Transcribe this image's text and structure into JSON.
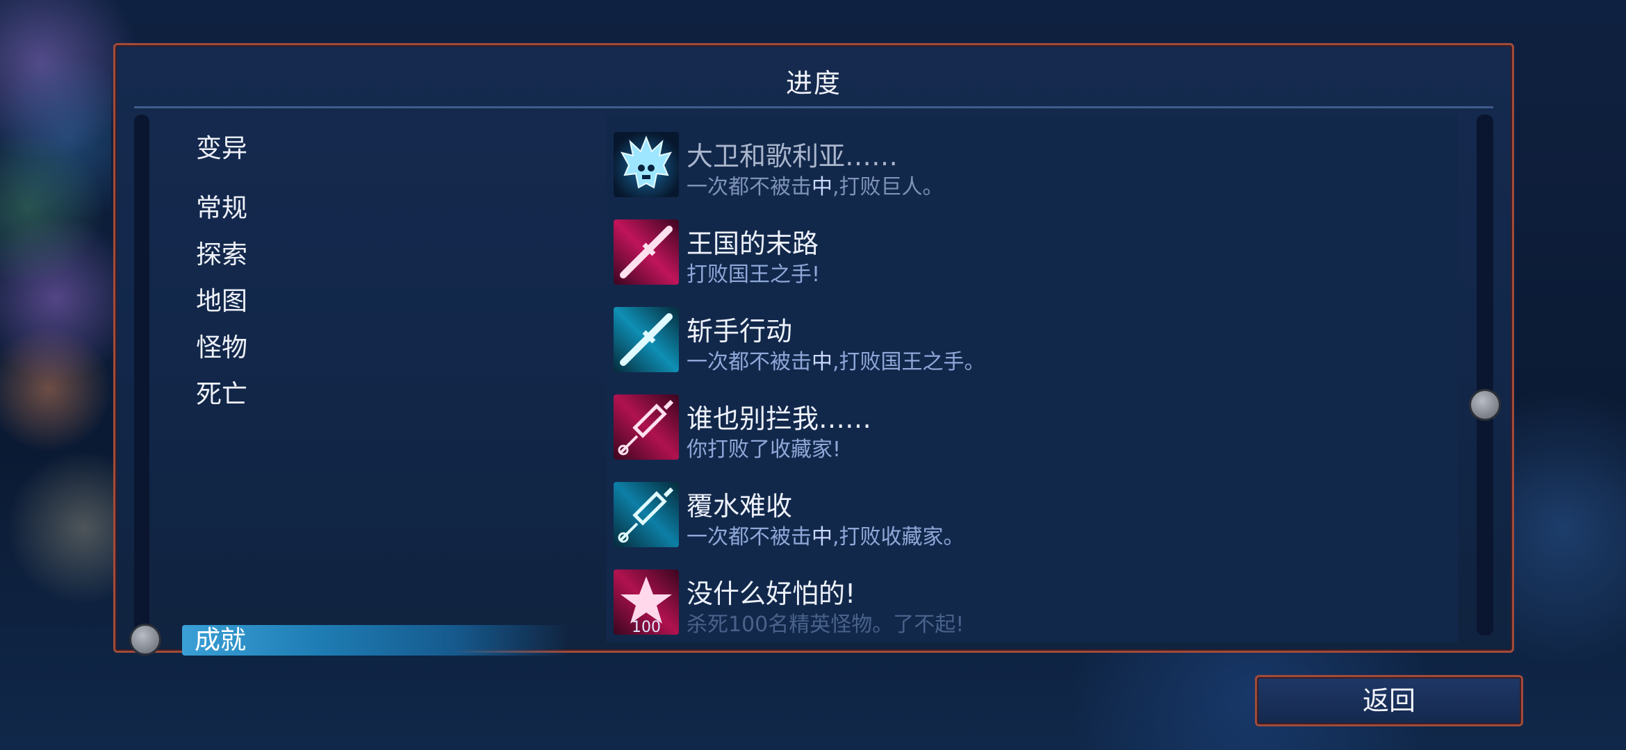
{
  "panel": {
    "title": "进度"
  },
  "categories": [
    {
      "label": "变异",
      "selected": false
    },
    {
      "label": "常规",
      "selected": false
    },
    {
      "label": "探索",
      "selected": false
    },
    {
      "label": "地图",
      "selected": false
    },
    {
      "label": "怪物",
      "selected": false
    },
    {
      "label": "死亡",
      "selected": false
    },
    {
      "label": "成就",
      "selected": true
    }
  ],
  "achievements": [
    {
      "title": "大卫和歌利亚……",
      "desc_pre": "一次都不被击",
      "desc_hl": "中",
      "desc_post": ",打败巨人。",
      "icon": "giant-skull-icon",
      "unlocked": false
    },
    {
      "title": "王国的末路",
      "desc": "打败国王之手!",
      "icon": "pink-sword-icon",
      "unlocked": true
    },
    {
      "title": "斩手行动",
      "desc_pre": "一次都不被击",
      "desc_hl": "中",
      "desc_post": ",打败国王之手。",
      "icon": "cyan-sword-icon",
      "unlocked": true
    },
    {
      "title": "谁也别拦我……",
      "desc": "你打败了收藏家!",
      "icon": "pink-syringe-icon",
      "unlocked": true
    },
    {
      "title": "覆水难收",
      "desc_pre": "一次都不被击",
      "desc_hl": "中",
      "desc_post": ",打败收藏家。",
      "icon": "cyan-syringe-icon",
      "unlocked": true
    },
    {
      "title": "没什么好怕的!",
      "desc": "杀死100名精英怪物。了不起!",
      "icon": "pink-star-icon",
      "icon_text": "100",
      "unlocked": true
    }
  ],
  "footer": {
    "back_label": "返回"
  },
  "colors": {
    "panel_border": "#a24b3a",
    "selected_cat": "#3aa0d6",
    "desc_text": "#8fa8d8"
  }
}
